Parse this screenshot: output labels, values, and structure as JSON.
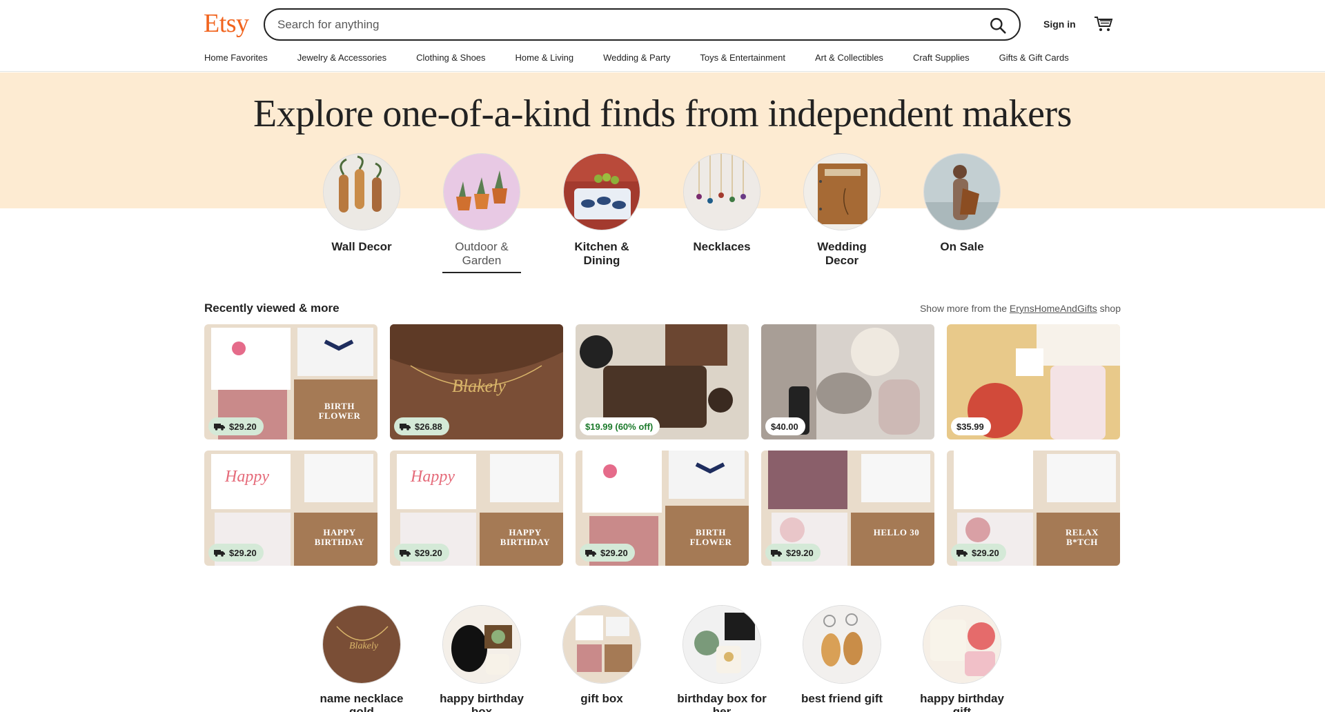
{
  "header": {
    "logo": "Etsy",
    "search_placeholder": "Search for anything",
    "signin_label": "Sign in",
    "nav": [
      "Home Favorites",
      "Jewelry & Accessories",
      "Clothing & Shoes",
      "Home & Living",
      "Wedding & Party",
      "Toys & Entertainment",
      "Art & Collectibles",
      "Craft Supplies",
      "Gifts & Gift Cards"
    ]
  },
  "hero": {
    "title": "Explore one-of-a-kind finds from independent makers",
    "categories": [
      {
        "label": "Wall Decor"
      },
      {
        "label": "Outdoor & Garden"
      },
      {
        "label": "Kitchen & Dining"
      },
      {
        "label": "Necklaces"
      },
      {
        "label": "Wedding Decor"
      },
      {
        "label": "On Sale"
      }
    ],
    "active_category": "Outdoor & Garden"
  },
  "recently_viewed": {
    "title": "Recently viewed & more",
    "more_prefix": "Show more from the",
    "shop_name": "ErynsHomeAndGifts",
    "more_suffix": "shop",
    "items": [
      {
        "price": "$29.20",
        "caption": "BIRTH FLOWER"
      },
      {
        "price": "$26.88",
        "caption": ""
      },
      {
        "price": "$19.99 (60% off)",
        "caption": ""
      },
      {
        "price": "$40.00",
        "caption": ""
      },
      {
        "price": "$35.99",
        "caption": ""
      },
      {
        "price": "$29.20",
        "caption": "HAPPY BIRTHDAY"
      },
      {
        "price": "$29.20",
        "caption": "HAPPY BIRTHDAY"
      },
      {
        "price": "$29.20",
        "caption": "BIRTH FLOWER"
      },
      {
        "price": "$29.20",
        "caption": "HELLO 30"
      },
      {
        "price": "$29.20",
        "caption": "RELAX B*TCH"
      }
    ]
  },
  "popular_searches": [
    {
      "label": "name necklace gold"
    },
    {
      "label": "happy birthday box"
    },
    {
      "label": "gift box"
    },
    {
      "label": "birthday box for her"
    },
    {
      "label": "best friend gift"
    },
    {
      "label": "happy birthday gift"
    }
  ],
  "colors": {
    "brand": "#f1641e",
    "hero_band": "#fdebd2",
    "free_shipping_badge": "#d4e9d7",
    "sale_text": "#1b7a2b"
  }
}
